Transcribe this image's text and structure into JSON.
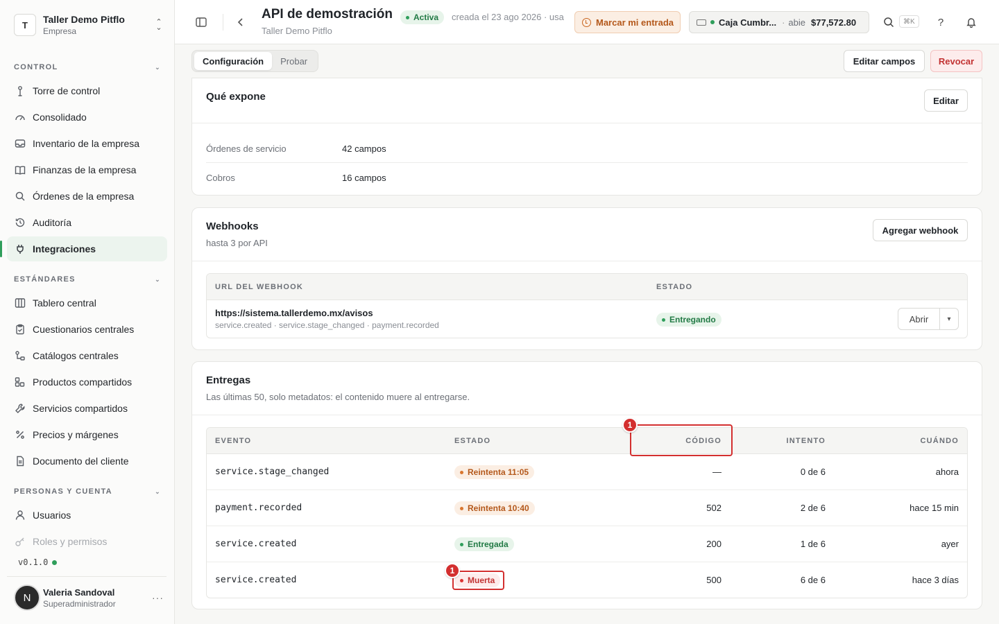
{
  "workspace": {
    "initial": "T",
    "name": "Taller Demo Pitflo",
    "type": "Empresa"
  },
  "sidebar": {
    "sections": [
      {
        "title": "CONTROL",
        "items": [
          {
            "label": "Torre de control",
            "icon": "tower-icon"
          },
          {
            "label": "Consolidado",
            "icon": "gauge-icon"
          },
          {
            "label": "Inventario de la empresa",
            "icon": "inbox-icon"
          },
          {
            "label": "Finanzas de la empresa",
            "icon": "book-icon"
          },
          {
            "label": "Órdenes de la empresa",
            "icon": "search-icon"
          },
          {
            "label": "Auditoría",
            "icon": "history-icon"
          },
          {
            "label": "Integraciones",
            "icon": "plug-icon",
            "active": true
          }
        ]
      },
      {
        "title": "ESTÁNDARES",
        "items": [
          {
            "label": "Tablero central",
            "icon": "columns-icon"
          },
          {
            "label": "Cuestionarios centrales",
            "icon": "clipboard-icon"
          },
          {
            "label": "Catálogos centrales",
            "icon": "hierarchy-icon"
          },
          {
            "label": "Productos compartidos",
            "icon": "boxes-icon"
          },
          {
            "label": "Servicios compartidos",
            "icon": "wrench-icon"
          },
          {
            "label": "Precios y márgenes",
            "icon": "percent-icon"
          },
          {
            "label": "Documento del cliente",
            "icon": "document-icon"
          }
        ]
      },
      {
        "title": "PERSONAS Y CUENTA",
        "items": [
          {
            "label": "Usuarios",
            "icon": "user-icon"
          },
          {
            "label": "Roles y permisos",
            "icon": "key-icon",
            "faded": true
          }
        ]
      }
    ],
    "version": "v0.1.0"
  },
  "user": {
    "initial": "N",
    "name": "Valeria Sandoval",
    "role": "Superadministrador"
  },
  "header": {
    "title": "API de demostración",
    "subtitle": "Taller Demo Pitflo",
    "status": "Activa",
    "created": "creada el 23 ago 2026 · usa",
    "entry_button": "Marcar mi entrada",
    "cashbox": {
      "name": "Caja Cumbr...",
      "state": "abie",
      "amount": "$77,572.80"
    },
    "shortcut": "⌘K"
  },
  "tabs": [
    {
      "label": "Configuración",
      "active": true
    },
    {
      "label": "Probar"
    }
  ],
  "actions": {
    "edit_fields": "Editar campos",
    "revoke": "Revocar"
  },
  "exposes": {
    "title": "Qué expone",
    "edit": "Editar",
    "rows": [
      {
        "label": "Órdenes de servicio",
        "value": "42 campos"
      },
      {
        "label": "Cobros",
        "value": "16 campos"
      }
    ]
  },
  "webhooks": {
    "title": "Webhooks",
    "subtitle": "hasta 3 por API",
    "add": "Agregar webhook",
    "columns": {
      "url": "URL DEL WEBHOOK",
      "status": "ESTADO"
    },
    "rows": [
      {
        "url": "https://sistema.tallerdemo.mx/avisos",
        "events": "service.created · service.stage_changed · payment.recorded",
        "status": "Entregando",
        "open": "Abrir"
      }
    ]
  },
  "deliveries": {
    "title": "Entregas",
    "subtitle": "Las últimas 50, solo metadatos: el contenido muere al entregarse.",
    "columns": {
      "event": "EVENTO",
      "status": "ESTADO",
      "code": "CÓDIGO",
      "attempt": "INTENTO",
      "when": "CUÁNDO"
    },
    "rows": [
      {
        "event": "service.stage_changed",
        "status": "Reintenta 11:05",
        "tone": "orange",
        "code": "—",
        "attempt": "0 de 6",
        "when": "ahora"
      },
      {
        "event": "payment.recorded",
        "status": "Reintenta 10:40",
        "tone": "orange",
        "code": "502",
        "attempt": "2 de 6",
        "when": "hace 15 min"
      },
      {
        "event": "service.created",
        "status": "Entregada",
        "tone": "green",
        "code": "200",
        "attempt": "1 de 6",
        "when": "ayer"
      },
      {
        "event": "service.created",
        "status": "Muerta",
        "tone": "red",
        "code": "500",
        "attempt": "6 de 6",
        "when": "hace 3 días"
      }
    ]
  },
  "annotations": {
    "code_header": "1",
    "dead_status": "1"
  },
  "colors": {
    "accent_green": "#2f9e5b",
    "warn_orange": "#d9762f",
    "danger_red": "#d32f2f"
  }
}
